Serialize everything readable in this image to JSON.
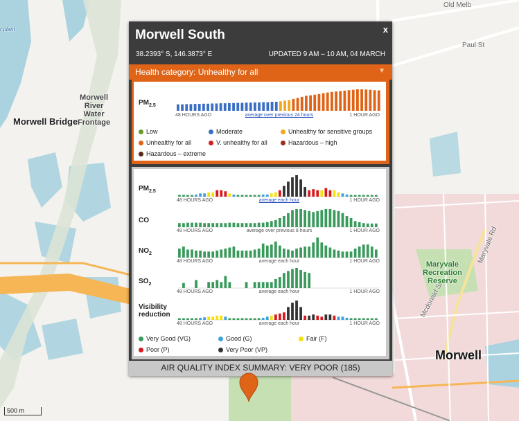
{
  "map": {
    "labels": {
      "old_melb": "Old Melb",
      "paul_st": "Paul St",
      "mcdonald_st": "Mcdonald St",
      "maryvale_rd": "Maryvale Rd",
      "morwell_bridge": "Morwell Bridge",
      "morwell_river": "Morwell\nRiver\nWater\nFrontage",
      "maryvale_reserve": "Maryvale\nRecreation\nReserve",
      "morwell": "Morwell",
      "power_plant": "t plant",
      "scale": "500 m"
    },
    "colors": {
      "water": "#aad3df",
      "road_major": "#f6b656",
      "green": "#c6e0b4",
      "urban": "#f2dada"
    }
  },
  "popup": {
    "station": "Morwell South",
    "close_label": "x",
    "coords": "38.2393° S, 146.3873° E",
    "updated": "UPDATED 9 AM – 10 AM, 04 MARCH",
    "health_category": "Health category: Unhealthy for all",
    "health_arrow": "▼",
    "pm_label_main": "PM",
    "pm_label_sub": "2.5",
    "axis_left": "48 HOURS AGO",
    "axis_right": "1 HOUR AGO",
    "pm_axis_center": "average over previous 24 hours",
    "health_legend": [
      {
        "label": "Low",
        "color": "#6b9a2a"
      },
      {
        "label": "Moderate",
        "color": "#3b6fc4"
      },
      {
        "label": "Unhealthy for sensitive groups",
        "color": "#f0a81e"
      },
      {
        "label": "Unhealthy for all",
        "color": "#e06417"
      },
      {
        "label": "V. unhealthy for all",
        "color": "#d42020"
      },
      {
        "label": "Hazardous – high",
        "color": "#9b2d1c"
      },
      {
        "label": "Hazardous – extreme",
        "color": "#5a2a1a"
      }
    ],
    "rows": [
      {
        "label": "PM",
        "sub": "2.5",
        "center": "average each hour",
        "link": true
      },
      {
        "label": "CO",
        "sub": "",
        "center": "average over previous 8 hours",
        "link": false
      },
      {
        "label": "NO",
        "sub": "2",
        "center": "average each hour",
        "link": false
      },
      {
        "label": "SO",
        "sub": "2",
        "center": "average each hour",
        "link": false
      },
      {
        "label": "Visibility reduction",
        "sub": "",
        "center": "average each hour",
        "link": false
      }
    ],
    "aqi_legend": [
      {
        "label": "Very Good (VG)",
        "color": "#3a9a5c"
      },
      {
        "label": "Good (G)",
        "color": "#3da0e0"
      },
      {
        "label": "Fair (F)",
        "color": "#f5e10a"
      },
      {
        "label": "Poor (P)",
        "color": "#d7191c"
      },
      {
        "label": "Very Poor (VP)",
        "color": "#333333"
      }
    ],
    "aqi_summary": "AIR QUALITY INDEX SUMMARY: VERY POOR (185)"
  },
  "chart_data": [
    {
      "type": "bar",
      "title": "PM2.5 24h average",
      "x": "48 hours ago to 1 hour ago",
      "color_key": [
        "#3b6fc4",
        "#f0a81e",
        "#e06417"
      ],
      "values": [
        0.3,
        0.3,
        0.31,
        0.31,
        0.32,
        0.32,
        0.33,
        0.33,
        0.34,
        0.34,
        0.35,
        0.35,
        0.36,
        0.36,
        0.37,
        0.37,
        0.38,
        0.38,
        0.39,
        0.39,
        0.4,
        0.4,
        0.42,
        0.42,
        0.44,
        0.47,
        0.5,
        0.55,
        0.6,
        0.65,
        0.7,
        0.72,
        0.75,
        0.78,
        0.82,
        0.85,
        0.88,
        0.9,
        0.92,
        0.94,
        0.96,
        0.98,
        1.0,
        1.0,
        0.99,
        0.98,
        0.96,
        0.95
      ],
      "categories": [
        0,
        0,
        0,
        0,
        0,
        0,
        0,
        0,
        0,
        0,
        0,
        0,
        0,
        0,
        0,
        0,
        0,
        0,
        0,
        0,
        0,
        0,
        0,
        0,
        1,
        1,
        1,
        2,
        2,
        2,
        2,
        2,
        2,
        2,
        2,
        2,
        2,
        2,
        2,
        2,
        2,
        2,
        2,
        2,
        2,
        2,
        2,
        2
      ]
    },
    {
      "type": "bar",
      "title": "PM2.5 hourly",
      "color_key": [
        "#3a9a5c",
        "#3da0e0",
        "#f5e10a",
        "#d7191c",
        "#333333"
      ],
      "values": [
        0.08,
        0.08,
        0.08,
        0.08,
        0.1,
        0.15,
        0.15,
        0.2,
        0.2,
        0.3,
        0.3,
        0.25,
        0.15,
        0.1,
        0.08,
        0.08,
        0.08,
        0.08,
        0.08,
        0.08,
        0.1,
        0.1,
        0.15,
        0.2,
        0.3,
        0.5,
        0.7,
        0.9,
        1.0,
        0.8,
        0.45,
        0.3,
        0.35,
        0.3,
        0.3,
        0.4,
        0.3,
        0.3,
        0.2,
        0.15,
        0.1,
        0.08,
        0.08,
        0.08,
        0.08,
        0.08,
        0.08,
        0.08
      ],
      "categories": [
        0,
        0,
        0,
        0,
        1,
        1,
        1,
        2,
        2,
        3,
        3,
        3,
        2,
        1,
        0,
        0,
        0,
        0,
        0,
        0,
        1,
        1,
        2,
        2,
        3,
        4,
        4,
        4,
        4,
        4,
        4,
        3,
        3,
        3,
        2,
        3,
        3,
        2,
        2,
        1,
        1,
        0,
        0,
        0,
        0,
        0,
        0,
        0
      ]
    },
    {
      "type": "bar",
      "title": "CO",
      "values": [
        0.2,
        0.2,
        0.22,
        0.22,
        0.22,
        0.22,
        0.2,
        0.2,
        0.2,
        0.2,
        0.2,
        0.2,
        0.22,
        0.22,
        0.2,
        0.2,
        0.2,
        0.2,
        0.2,
        0.22,
        0.22,
        0.25,
        0.3,
        0.35,
        0.45,
        0.55,
        0.7,
        0.85,
        0.9,
        0.9,
        0.85,
        0.8,
        0.75,
        0.8,
        0.85,
        0.9,
        0.9,
        0.85,
        0.8,
        0.7,
        0.55,
        0.45,
        0.3,
        0.25,
        0.2,
        0.18,
        0.18,
        0.18
      ]
    },
    {
      "type": "bar",
      "title": "NO2",
      "values": [
        0.45,
        0.55,
        0.4,
        0.4,
        0.35,
        0.35,
        0.3,
        0.3,
        0.3,
        0.35,
        0.4,
        0.45,
        0.5,
        0.55,
        0.35,
        0.35,
        0.35,
        0.35,
        0.4,
        0.45,
        0.7,
        0.6,
        0.65,
        0.8,
        0.6,
        0.45,
        0.4,
        0.35,
        0.45,
        0.5,
        0.55,
        0.55,
        0.75,
        1.0,
        0.75,
        0.6,
        0.5,
        0.4,
        0.35,
        0.3,
        0.3,
        0.3,
        0.45,
        0.55,
        0.65,
        0.65,
        0.55,
        0.4
      ]
    },
    {
      "type": "bar",
      "title": "SO2",
      "values": [
        0.0,
        0.25,
        0.0,
        0.0,
        0.4,
        0.0,
        0.0,
        0.3,
        0.3,
        0.4,
        0.3,
        0.6,
        0.3,
        0.0,
        0.0,
        0.0,
        0.3,
        0.0,
        0.3,
        0.3,
        0.3,
        0.3,
        0.3,
        0.45,
        0.55,
        0.75,
        0.85,
        0.95,
        1.0,
        0.9,
        0.8,
        0.75,
        0.0,
        0.0,
        0.0,
        0.0,
        0.0,
        0.0,
        0.0,
        0.0,
        0.0,
        0.0,
        0.0,
        0.0,
        0.0,
        0.0,
        0.0,
        0.0
      ]
    },
    {
      "type": "bar",
      "title": "Visibility reduction",
      "color_key": [
        "#3a9a5c",
        "#3da0e0",
        "#f5e10a",
        "#d7191c",
        "#333333"
      ],
      "values": [
        0.08,
        0.08,
        0.08,
        0.08,
        0.08,
        0.1,
        0.12,
        0.15,
        0.15,
        0.2,
        0.2,
        0.15,
        0.08,
        0.08,
        0.08,
        0.08,
        0.08,
        0.08,
        0.08,
        0.08,
        0.1,
        0.15,
        0.2,
        0.25,
        0.3,
        0.35,
        0.6,
        0.8,
        0.9,
        0.6,
        0.2,
        0.2,
        0.25,
        0.2,
        0.15,
        0.25,
        0.25,
        0.2,
        0.15,
        0.15,
        0.1,
        0.08,
        0.08,
        0.08,
        0.08,
        0.08,
        0.08,
        0.08
      ],
      "categories": [
        0,
        0,
        0,
        0,
        0,
        1,
        1,
        2,
        2,
        2,
        2,
        1,
        0,
        0,
        0,
        0,
        0,
        0,
        0,
        0,
        1,
        1,
        2,
        3,
        3,
        3,
        4,
        4,
        4,
        4,
        3,
        4,
        4,
        3,
        3,
        4,
        4,
        3,
        1,
        1,
        1,
        0,
        0,
        0,
        0,
        0,
        0,
        0
      ]
    }
  ]
}
